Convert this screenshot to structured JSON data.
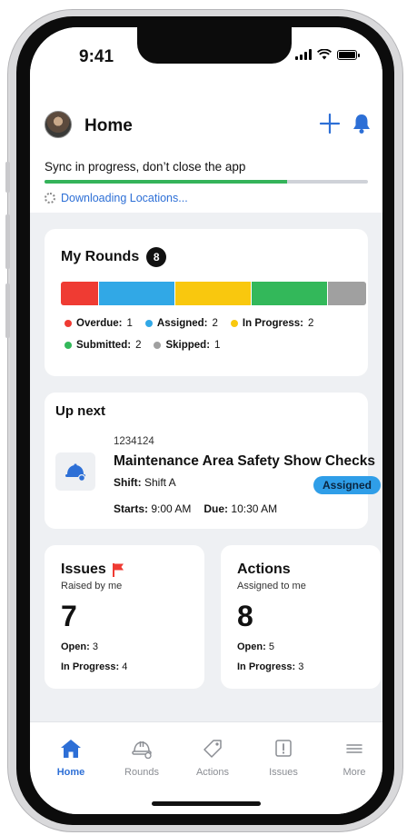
{
  "status_bar": {
    "time": "9:41"
  },
  "header": {
    "title": "Home"
  },
  "sync": {
    "message": "Sync in progress, don’t close the app",
    "progress_fraction": 0.75,
    "status": "Downloading Locations..."
  },
  "my_rounds": {
    "title": "My Rounds",
    "total": "8",
    "segments": [
      {
        "label": "Overdue:",
        "count": "1",
        "color": "#ef3b33"
      },
      {
        "label": "Assigned:",
        "count": "2",
        "color": "#31a8e6"
      },
      {
        "label": "In Progress:",
        "count": "2",
        "color": "#f9c80e"
      },
      {
        "label": "Submitted:",
        "count": "2",
        "color": "#33b85a"
      },
      {
        "label": "Skipped:",
        "count": "1",
        "color": "#a0a0a0"
      }
    ]
  },
  "up_next": {
    "title": "Up next",
    "round_id": "1234124",
    "round_name": "Maintenance Area Safety Show Checks",
    "shift_label": "Shift:",
    "shift_value": "Shift A",
    "status": "Assigned",
    "starts_label": "Starts:",
    "starts_value": "9:00 AM",
    "due_label": "Due:",
    "due_value": "10:30 AM"
  },
  "issues": {
    "title": "Issues",
    "subtitle": "Raised by me",
    "count": "7",
    "open_label": "Open:",
    "open_value": "3",
    "in_progress_label": "In Progress:",
    "in_progress_value": "4"
  },
  "actions": {
    "title": "Actions",
    "subtitle": "Assigned to me",
    "count": "8",
    "open_label": "Open:",
    "open_value": "5",
    "in_progress_label": "In Progress:",
    "in_progress_value": "3"
  },
  "tabs": [
    {
      "label": "Home",
      "icon": "home-icon"
    },
    {
      "label": "Rounds",
      "icon": "hardhat-icon"
    },
    {
      "label": "Actions",
      "icon": "tag-icon"
    },
    {
      "label": "Issues",
      "icon": "alert-icon"
    },
    {
      "label": "More",
      "icon": "menu-icon"
    }
  ],
  "colors": {
    "accent": "#2d6fd6",
    "success": "#34b35a",
    "flag": "#ef3b33"
  }
}
